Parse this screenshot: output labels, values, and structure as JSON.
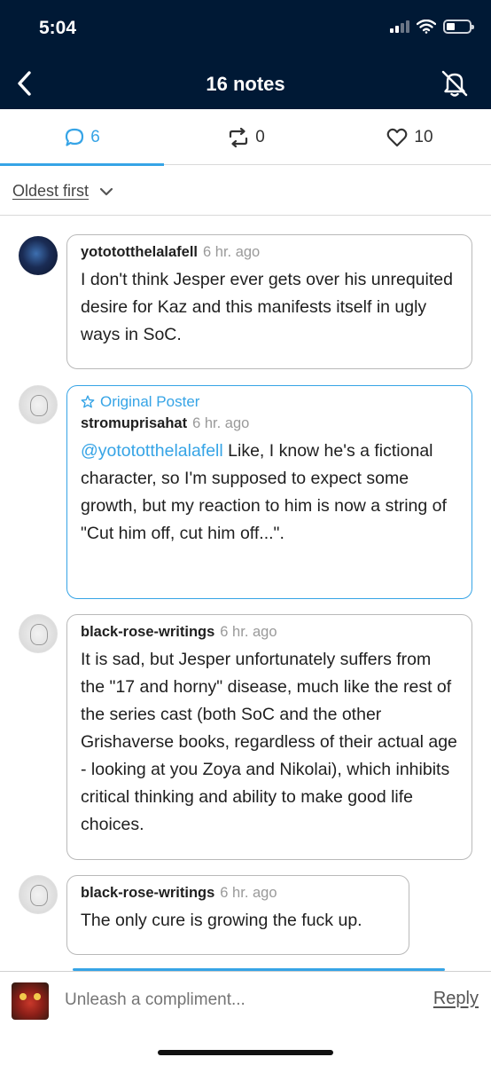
{
  "status_bar": {
    "time": "5:04"
  },
  "header": {
    "title": "16 notes"
  },
  "tabs": [
    {
      "name": "replies",
      "icon": "speech-bubble-icon",
      "count": "6",
      "active": true
    },
    {
      "name": "reblogs",
      "icon": "reblog-icon",
      "count": "0",
      "active": false
    },
    {
      "name": "likes",
      "icon": "heart-icon",
      "count": "10",
      "active": false
    }
  ],
  "sort": {
    "label": "Oldest first"
  },
  "comments": [
    {
      "username": "yotototthelalafell",
      "time": "6 hr. ago",
      "text": "I don't think Jesper ever gets over his unrequited desire for Kaz and this manifests itself in ugly ways in SoC."
    },
    {
      "op_label": "Original Poster",
      "username": "stromuprisahat",
      "time": "6 hr. ago",
      "mention": "@yotototthelalafell",
      "text": " Like, I know he's a fictional character, so I'm supposed to expect some growth, but my reaction to him is now a string of \"Cut him off, cut him off...\"."
    },
    {
      "username": "black-rose-writings",
      "time": "6 hr. ago",
      "text": "It is sad, but Jesper unfortunately suffers from the \"17 and horny\" disease, much like the rest of the series cast (both SoC and the other Grishaverse books, regardless of their actual age - looking at you Zoya and Nikolai), which inhibits critical thinking and ability to make good life choices."
    },
    {
      "username": "black-rose-writings",
      "time": "6 hr. ago",
      "text": "The only cure is growing the fuck up."
    }
  ],
  "composer": {
    "placeholder": "Unleash a compliment...",
    "reply_label": "Reply"
  },
  "colors": {
    "header_bg": "#001935",
    "accent": "#36a4e6"
  }
}
